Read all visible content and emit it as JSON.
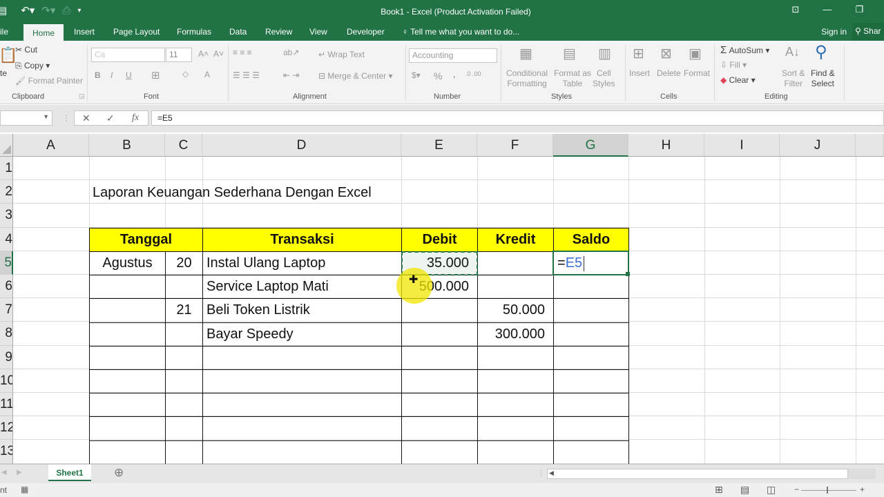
{
  "window": {
    "title": "Book1 - Excel (Product Activation Failed)",
    "qat": {
      "save_icon": "save-icon",
      "undo_icon": "undo-icon",
      "redo_icon": "redo-icon",
      "customize_icon": "customize-qat-icon"
    }
  },
  "tabs": [
    {
      "label": "ile"
    },
    {
      "label": "Home"
    },
    {
      "label": "Insert"
    },
    {
      "label": "Page Layout"
    },
    {
      "label": "Formulas"
    },
    {
      "label": "Data"
    },
    {
      "label": "Review"
    },
    {
      "label": "View"
    },
    {
      "label": "Developer"
    }
  ],
  "tell_me": "Tell me what you want to do...",
  "sign_in": "Sign in",
  "share": "Shar",
  "ribbon": {
    "clipboard": {
      "paste": "te",
      "cut": "Cut",
      "copy": "Copy",
      "format_painter": "Format Painter",
      "label": "Clipboard"
    },
    "font": {
      "font_name": "Ca",
      "font_size": "11",
      "bold": "B",
      "italic": "I",
      "underline": "U",
      "label": "Font"
    },
    "alignment": {
      "wrap_text": "Wrap Text",
      "merge_center": "Merge & Center",
      "label": "Alignment"
    },
    "number": {
      "format": "Accounting",
      "percent": "%",
      "comma": ",",
      "label": "Number"
    },
    "styles": {
      "conditional_formatting": [
        "Conditional",
        "Formatting"
      ],
      "format_as_table": [
        "Format as",
        "Table"
      ],
      "cell_styles": [
        "Cell",
        "Styles"
      ],
      "label": "Styles"
    },
    "cells": {
      "insert": "Insert",
      "delete": "Delete",
      "format": "Format",
      "label": "Cells"
    },
    "editing": {
      "autosum": "AutoSum",
      "fill": "Fill",
      "clear": "Clear",
      "sort_filter": [
        "Sort &",
        "Filter"
      ],
      "find_select": [
        "Find &",
        "Select"
      ],
      "label": "Editing"
    }
  },
  "formula_bar": {
    "name_box": "",
    "cancel": "✕",
    "enter": "✓",
    "fx": "fx",
    "formula": "=E5"
  },
  "columns": [
    "A",
    "B",
    "C",
    "D",
    "E",
    "F",
    "G",
    "H",
    "I",
    "J"
  ],
  "rows": [
    "1",
    "2",
    "3",
    "4",
    "5",
    "6",
    "7",
    "8",
    "9",
    "10",
    "11",
    "12",
    "13"
  ],
  "sheet": {
    "title": "Laporan Keuangan Sederhana Dengan Excel",
    "headers": {
      "tanggal": "Tanggal",
      "transaksi": "Transaksi",
      "debit": "Debit",
      "kredit": "Kredit",
      "saldo": "Saldo"
    },
    "records": [
      {
        "month": "Agustus",
        "day": "20",
        "transaksi": "Instal Ulang Laptop",
        "debit": "35.000",
        "kredit": "",
        "saldo": "=E5"
      },
      {
        "month": "",
        "day": "",
        "transaksi": "Service Laptop Mati",
        "debit": "500.000",
        "kredit": "",
        "saldo": ""
      },
      {
        "month": "",
        "day": "21",
        "transaksi": "Beli Token Listrik",
        "debit": "",
        "kredit": "50.000",
        "saldo": ""
      },
      {
        "month": "",
        "day": "",
        "transaksi": "Bayar Speedy",
        "debit": "",
        "kredit": "300.000",
        "saldo": ""
      }
    ],
    "active_cell": "G5",
    "copy_source": "E5"
  },
  "sheet_tabs": [
    {
      "label": "Sheet1"
    }
  ],
  "status": {
    "mode": "nt"
  },
  "colors": {
    "excel_green": "#217346",
    "header_fill": "#ffff00",
    "ref_blue": "#3b6fd6"
  }
}
